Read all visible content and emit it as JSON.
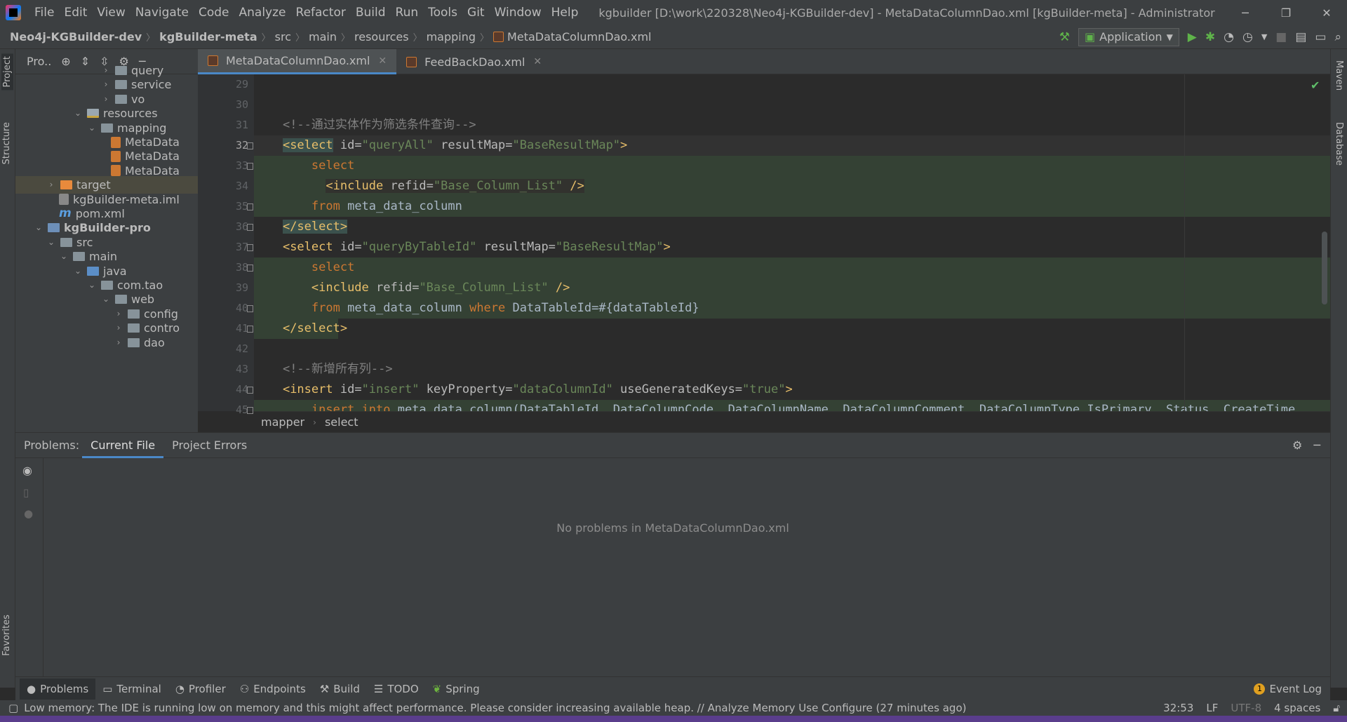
{
  "window": {
    "title": "kgbuilder [D:\\work\\220328\\Neo4j-KGBuilder-dev] - MetaDataColumnDao.xml [kgBuilder-meta] - Administrator",
    "menu": [
      "File",
      "Edit",
      "View",
      "Navigate",
      "Code",
      "Analyze",
      "Refactor",
      "Build",
      "Run",
      "Tools",
      "Git",
      "Window",
      "Help"
    ]
  },
  "breadcrumb": [
    "Neo4j-KGBuilder-dev",
    "kgBuilder-meta",
    "src",
    "main",
    "resources",
    "mapping",
    "MetaDataColumnDao.xml"
  ],
  "run_config": "Application",
  "project_panel": {
    "title": "Pro..",
    "tree": [
      {
        "label": "query",
        "type": "folder",
        "chev": "›"
      },
      {
        "label": "service",
        "type": "folder",
        "chev": "›"
      },
      {
        "label": "vo",
        "type": "folder",
        "chev": "›"
      },
      {
        "label": "resources",
        "type": "res",
        "chev": "⌄"
      },
      {
        "label": "mapping",
        "type": "folder",
        "chev": "⌄"
      },
      {
        "label": "MetaData",
        "type": "xml",
        "chev": ""
      },
      {
        "label": "MetaData",
        "type": "xml",
        "chev": ""
      },
      {
        "label": "MetaData",
        "type": "xml",
        "chev": ""
      },
      {
        "label": "target",
        "type": "target",
        "chev": "›"
      },
      {
        "label": "kgBuilder-meta.iml",
        "type": "iml",
        "chev": ""
      },
      {
        "label": "pom.xml",
        "type": "pom",
        "chev": ""
      },
      {
        "label": "kgBuilder-pro",
        "type": "module",
        "chev": "⌄"
      },
      {
        "label": "src",
        "type": "folder",
        "chev": "⌄"
      },
      {
        "label": "main",
        "type": "folder",
        "chev": "⌄"
      },
      {
        "label": "java",
        "type": "src",
        "chev": "⌄"
      },
      {
        "label": "com.tao",
        "type": "folder",
        "chev": "⌄"
      },
      {
        "label": "web",
        "type": "folder",
        "chev": "⌄"
      },
      {
        "label": "config",
        "type": "folder",
        "chev": "›"
      },
      {
        "label": "contro",
        "type": "folder",
        "chev": "›"
      },
      {
        "label": "dao",
        "type": "folder",
        "chev": "›"
      }
    ]
  },
  "editor_tabs": [
    {
      "label": "MetaDataColumnDao.xml",
      "active": true
    },
    {
      "label": "FeedBackDao.xml",
      "active": false
    }
  ],
  "line_numbers": [
    "29",
    "30",
    "31",
    "32",
    "33",
    "34",
    "35",
    "36",
    "37",
    "38",
    "39",
    "40",
    "41",
    "42",
    "43",
    "44",
    "45"
  ],
  "editor_breadcrumb": [
    "mapper",
    "select"
  ],
  "problems": {
    "label": "Problems:",
    "tabs": [
      "Current File",
      "Project Errors"
    ],
    "empty_message": "No problems in MetaDataColumnDao.xml"
  },
  "bottom_tools": [
    "Problems",
    "Terminal",
    "Profiler",
    "Endpoints",
    "Build",
    "TODO",
    "Spring"
  ],
  "event_log": {
    "label": "Event Log",
    "count": "1"
  },
  "status": {
    "message": "Low memory: The IDE is running low on memory and this might affect performance. Please consider increasing available heap. // Analyze Memory Use   Configure (27 minutes ago)",
    "position": "32:53",
    "line_sep": "LF",
    "encoding": "UTF-8",
    "indent": "4 spaces"
  },
  "side_tabs": {
    "left": [
      "Project",
      "Structure",
      "Favorites"
    ],
    "right": [
      "Maven",
      "Database"
    ]
  }
}
